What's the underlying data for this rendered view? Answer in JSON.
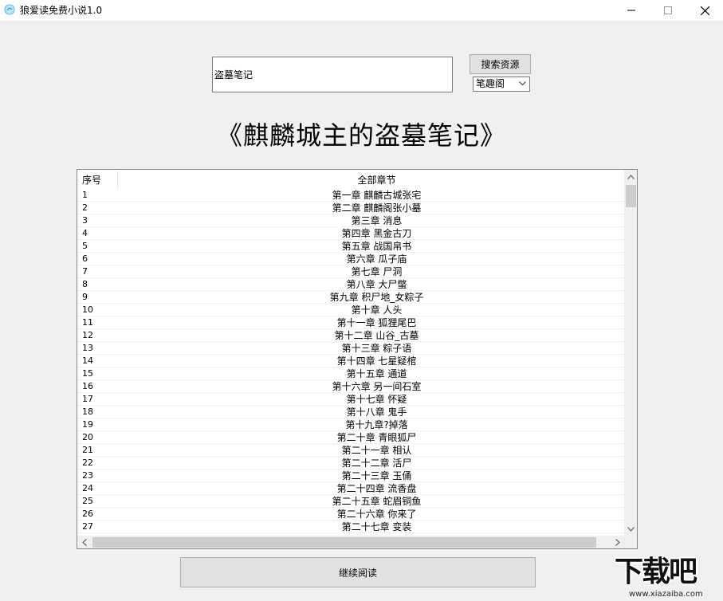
{
  "window": {
    "title": "狼爱读免费小说1.0",
    "icon": "app-icon",
    "controls": [
      "minimize-icon",
      "maximize-icon",
      "close-icon"
    ]
  },
  "search": {
    "value": "盗墓笔记",
    "button_label": "搜索资源",
    "source_selected": "笔趣阁"
  },
  "book": {
    "title": "《麒麟城主的盗墓笔记》"
  },
  "chapter_list": {
    "headers": {
      "num": "序号",
      "chapter": "全部章节"
    },
    "rows": [
      {
        "num": "1",
        "chapter": "第一章 麒麟古城张宅"
      },
      {
        "num": "2",
        "chapter": "第二章 麒麟阁张小墓"
      },
      {
        "num": "3",
        "chapter": "第三章 消息"
      },
      {
        "num": "4",
        "chapter": "第四章 黑金古刀"
      },
      {
        "num": "5",
        "chapter": "第五章 战国帛书"
      },
      {
        "num": "6",
        "chapter": "第六章 瓜子庙"
      },
      {
        "num": "7",
        "chapter": "第七章 尸洞"
      },
      {
        "num": "8",
        "chapter": "第八章 大尸蟞"
      },
      {
        "num": "9",
        "chapter": "第九章 积尸地_女粽子"
      },
      {
        "num": "10",
        "chapter": "第十章 人头"
      },
      {
        "num": "11",
        "chapter": "第十一章 狐狸尾巴"
      },
      {
        "num": "12",
        "chapter": "第十二章 山谷_古墓"
      },
      {
        "num": "13",
        "chapter": "第十三章 粽子语"
      },
      {
        "num": "14",
        "chapter": "第十四章 七星疑棺"
      },
      {
        "num": "15",
        "chapter": "第十五章 通道"
      },
      {
        "num": "16",
        "chapter": "第十六章 另一间石室"
      },
      {
        "num": "17",
        "chapter": "第十七章 怀疑"
      },
      {
        "num": "18",
        "chapter": "第十八章 鬼手"
      },
      {
        "num": "19",
        "chapter": "第十九章?掉落"
      },
      {
        "num": "20",
        "chapter": "第二十章 青眼狐尸"
      },
      {
        "num": "21",
        "chapter": "第二十一章 相认"
      },
      {
        "num": "22",
        "chapter": "第二十二章 活尸"
      },
      {
        "num": "23",
        "chapter": "第二十三章 玉俑"
      },
      {
        "num": "24",
        "chapter": "第二十四章 流香盘"
      },
      {
        "num": "25",
        "chapter": "第二十五章 蛇眉铜鱼"
      },
      {
        "num": "26",
        "chapter": "第二十六章 你来了"
      },
      {
        "num": "27",
        "chapter": "第二十七章 变装"
      }
    ]
  },
  "actions": {
    "continue_label": "继续阅读"
  },
  "watermark": {
    "main": "下载吧",
    "sub": "www.xiazaiba.com"
  },
  "colors": {
    "background": "#f0f0f0",
    "button": "#e1e1e1",
    "border": "#adadad"
  }
}
